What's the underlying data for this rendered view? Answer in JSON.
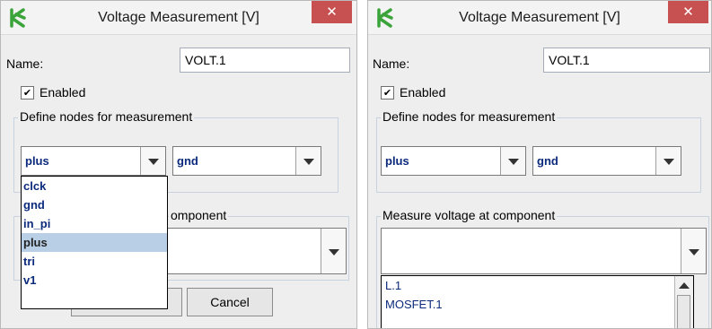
{
  "colors": {
    "close_bg": "#c75050",
    "item_text": "#0c2a7c",
    "selected_bg": "#b8cfe5",
    "icon_green": "#3aa33a"
  },
  "dialog1": {
    "title": "Voltage Measurement [V]",
    "close_glyph": "✕",
    "name_label": "Name:",
    "name_value": "VOLT.1",
    "enabled_label": "Enabled",
    "enabled_checked": true,
    "check_glyph": "✔",
    "nodes_group_label": "Define nodes for measurement",
    "node_plus_value": "plus",
    "node_minus_value": "gnd",
    "component_group_label_partial": "omponent",
    "node_options": [
      "clck",
      "gnd",
      "in_pi",
      "plus",
      "tri",
      "v1"
    ],
    "selected_option": "plus",
    "cancel_label": "Cancel"
  },
  "dialog2": {
    "title": "Voltage Measurement [V]",
    "close_glyph": "✕",
    "name_label": "Name:",
    "name_value": "VOLT.1",
    "enabled_label": "Enabled",
    "enabled_checked": true,
    "check_glyph": "✔",
    "nodes_group_label": "Define nodes for measurement",
    "node_plus_value": "plus",
    "node_minus_value": "gnd",
    "component_group_label": "Measure voltage at component",
    "component_value": "",
    "component_options": [
      "L.1",
      "MOSFET.1"
    ]
  }
}
